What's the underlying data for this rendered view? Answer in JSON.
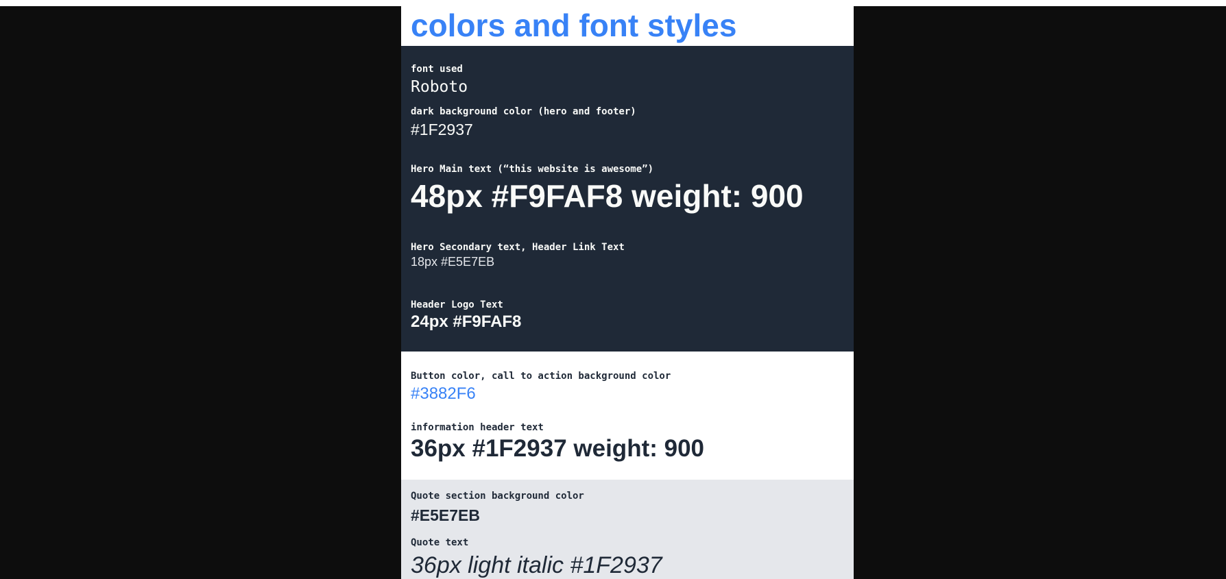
{
  "title": "colors and font styles",
  "colors": {
    "dark_bg": "#1F2937",
    "accent": "#3882F6",
    "light_text": "#F9FAF8",
    "secondary_text": "#E5E7EB",
    "quote_bg": "#E5E7EB",
    "page_bg": "#0d0d0d"
  },
  "dark_section": {
    "font_label": "font used",
    "font_value": "Roboto",
    "bg_label": "dark background color (hero and footer)",
    "bg_value": "#1F2937",
    "hero_main_label": "Hero Main text (“this website is awesome”)",
    "hero_main_value": "48px #F9FAF8 weight: 900",
    "hero_secondary_label": "Hero Secondary text, Header Link Text",
    "hero_secondary_value": "18px #E5E7EB",
    "logo_label": "Header Logo Text",
    "logo_value": "24px #F9FAF8"
  },
  "white_section": {
    "button_label": "Button color, call to action background color",
    "button_value": "#3882F6",
    "info_label": "information header text",
    "info_value": "36px #1F2937 weight: 900"
  },
  "grey_section": {
    "quote_bg_label": "Quote section background color",
    "quote_bg_value": "#E5E7EB",
    "quote_text_label": "Quote text",
    "quote_text_value": "36px light italic #1F2937"
  }
}
